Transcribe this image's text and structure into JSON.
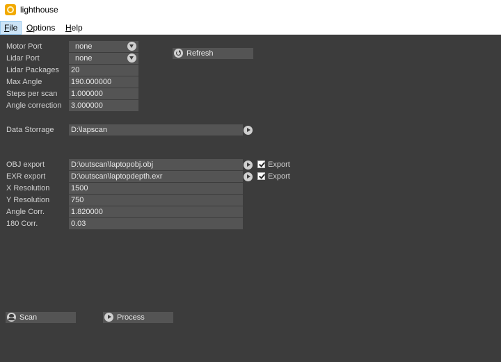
{
  "window": {
    "title": "lighthouse",
    "icon": "lighthouse-app-icon"
  },
  "menu": {
    "file": "File",
    "options": "Options",
    "help": "Help"
  },
  "port_settings": {
    "motor_port_label": "Motor Port",
    "motor_port_value": "none",
    "lidar_port_label": "Lidar Port",
    "lidar_port_value": "none",
    "refresh_label": "Refresh"
  },
  "scan_settings": {
    "lidar_packages_label": "Lidar Packages",
    "lidar_packages_value": "20",
    "max_angle_label": "Max Angle",
    "max_angle_value": "190.000000",
    "steps_per_scan_label": "Steps per scan",
    "steps_per_scan_value": "1.000000",
    "angle_correction_label": "Angle correction",
    "angle_correction_value": "3.000000"
  },
  "storage": {
    "data_storage_label": "Data Storrage",
    "data_storage_value": "D:\\lapscan"
  },
  "export": {
    "obj_label": "OBJ export",
    "obj_value": "D:\\outscan\\laptopobj.obj",
    "obj_checkbox_label": "Export",
    "obj_checked": true,
    "exr_label": "EXR export",
    "exr_value": "D:\\outscan\\laptopdepth.exr",
    "exr_checkbox_label": "Export",
    "exr_checked": true,
    "x_res_label": "X Resolution",
    "x_res_value": "1500",
    "y_res_label": "Y Resolution",
    "y_res_value": "750",
    "angle_corr_label": "Angle Corr.",
    "angle_corr_value": "1.820000",
    "corr180_label": "180 Corr.",
    "corr180_value": "0.03"
  },
  "actions": {
    "scan_label": "Scan",
    "process_label": "Process"
  },
  "colors": {
    "panel_bg": "#3c3c3c",
    "field_bg": "#545454",
    "text": "#dcdcdc",
    "menu_highlight": "#cce4f7"
  }
}
